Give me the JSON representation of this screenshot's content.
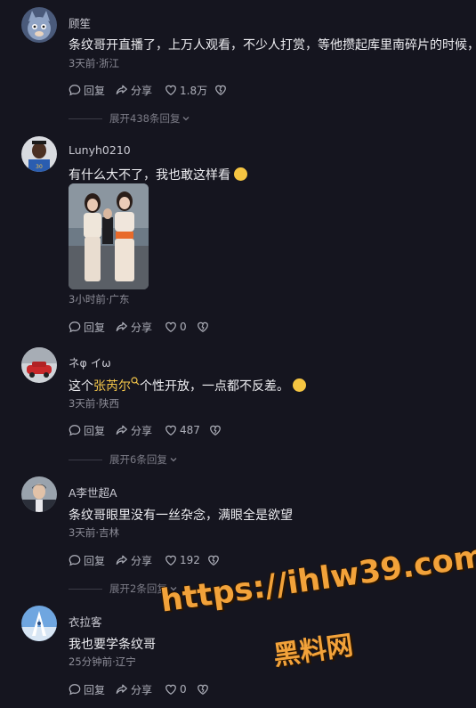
{
  "comments": [
    {
      "user": "顾笙",
      "text": "条纹哥开直播了，上万人观看，不少人打赏，等他攒起库里南碎片的时候，",
      "meta": "3天前·浙江",
      "reply": "回复",
      "share": "分享",
      "likes": "1.8万",
      "expand": "展开438条回复"
    },
    {
      "user": "Lunyh0210",
      "text": "有什么大不了，我也敢这样看",
      "meta": "3小时前·广东",
      "reply": "回复",
      "share": "分享",
      "likes": "0"
    },
    {
      "user": "ネφ イω",
      "text_pre": "这个",
      "mention": "张芮尔",
      "text_post": "个性开放，一点都不反差。",
      "meta": "3天前·陕西",
      "reply": "回复",
      "share": "分享",
      "likes": "487",
      "expand": "展开6条回复"
    },
    {
      "user": "A李世超A",
      "text": "条纹哥眼里没有一丝杂念，满眼全是欲望",
      "meta": "3天前·吉林",
      "reply": "回复",
      "share": "分享",
      "likes": "192",
      "expand": "展开2条回复"
    },
    {
      "user": "衣拉客",
      "text": "我也要学条纹哥",
      "meta": "25分钟前·辽宁",
      "reply": "回复",
      "share": "分享",
      "likes": "0"
    }
  ],
  "watermark": {
    "line1": "https://ihlw39.com",
    "line2": "黑料网"
  },
  "colors": {
    "background": "#15151f",
    "mention": "#f4c64a",
    "watermark": "#f2a23a"
  },
  "icons": [
    "reply-icon",
    "share-icon",
    "heart-icon",
    "dislike-icon",
    "chevron-down-icon",
    "search-icon"
  ]
}
